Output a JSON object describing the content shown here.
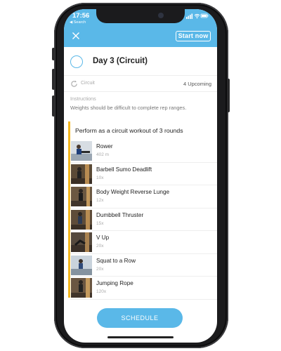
{
  "status": {
    "time": "17:56",
    "back_label": "◀ Search"
  },
  "header": {
    "start_label": "Start now"
  },
  "workout": {
    "title": "Day 3 (Circuit)"
  },
  "circuit_row": {
    "label": "Circuit",
    "upcoming": "4 Upcoming"
  },
  "instructions": {
    "label": "Instructions",
    "text": "Weights should be difficult to complete rep ranges."
  },
  "circuit": {
    "header": "Perform as a circuit workout of 3 rounds"
  },
  "exercises": [
    {
      "name": "Rower",
      "detail": "402 m"
    },
    {
      "name": "Barbell Sumo Deadlift",
      "detail": "10x"
    },
    {
      "name": "Body Weight Reverse Lunge",
      "detail": "12x"
    },
    {
      "name": "Dumbbell Thruster",
      "detail": "15x"
    },
    {
      "name": "V Up",
      "detail": "20x"
    },
    {
      "name": "Squat to a Row",
      "detail": "20x"
    },
    {
      "name": "Jumping Rope",
      "detail": "120x"
    }
  ],
  "footer": {
    "schedule_label": "SCHEDULE"
  },
  "colors": {
    "accent": "#5ab8e8",
    "circuit_bar": "#f3b61f",
    "phone": "#1b1b1d"
  }
}
